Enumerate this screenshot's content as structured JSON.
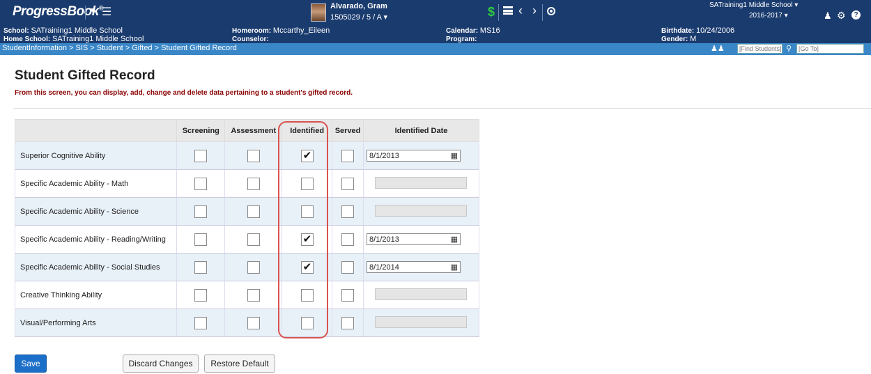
{
  "app": {
    "logo_text": "ProgressBook",
    "logo_mark": "®"
  },
  "student": {
    "name": "Alvarado, Gram",
    "id_line": "1505029  / 5 / A"
  },
  "header_right": {
    "school": "SATraining1 Middle School",
    "year": "2016-2017"
  },
  "info": {
    "school_label": "School:",
    "school_value": "SATraining1 Middle School",
    "home_school_label": "Home School:",
    "home_school_value": "SATraining1 Middle School",
    "homeroom_label": "Homeroom:",
    "homeroom_value": "Mccarthy_Eileen",
    "counselor_label": "Counselor:",
    "counselor_value": "",
    "calendar_label": "Calendar:",
    "calendar_value": "MS16",
    "program_label": "Program:",
    "program_value": "",
    "birthdate_label": "Birthdate:",
    "birthdate_value": "10/24/2006",
    "gender_label": "Gender:",
    "gender_value": "M"
  },
  "breadcrumb": "StudentInformation > SIS > Student > Gifted > Student Gifted Record",
  "search": {
    "find_placeholder": "[Find Students]",
    "goto_placeholder": "[Go To]"
  },
  "page": {
    "title": "Student Gifted Record",
    "description": "From this screen, you can display, add, change and delete data pertaining to a student's gifted record."
  },
  "table": {
    "headers": [
      "",
      "Screening",
      "Assessment",
      "Identified",
      "Served",
      "Identified Date"
    ],
    "rows": [
      {
        "name": "Superior Cognitive Ability",
        "screening": false,
        "assessment": false,
        "identified": true,
        "served": false,
        "date": "8/1/2013"
      },
      {
        "name": "Specific Academic Ability - Math",
        "screening": false,
        "assessment": false,
        "identified": false,
        "served": false,
        "date": ""
      },
      {
        "name": "Specific Academic Ability - Science",
        "screening": false,
        "assessment": false,
        "identified": false,
        "served": false,
        "date": ""
      },
      {
        "name": "Specific Academic Ability - Reading/Writing",
        "screening": false,
        "assessment": false,
        "identified": true,
        "served": false,
        "date": "8/1/2013"
      },
      {
        "name": "Specific Academic Ability - Social Studies",
        "screening": false,
        "assessment": false,
        "identified": true,
        "served": false,
        "date": "8/1/2014"
      },
      {
        "name": "Creative Thinking Ability",
        "screening": false,
        "assessment": false,
        "identified": false,
        "served": false,
        "date": ""
      },
      {
        "name": "Visual/Performing Arts",
        "screening": false,
        "assessment": false,
        "identified": false,
        "served": false,
        "date": ""
      }
    ]
  },
  "buttons": {
    "save": "Save",
    "discard": "Discard Changes",
    "restore": "Restore Default"
  },
  "colors": {
    "header_bg": "#1a3b6e",
    "breadcrumb_bg": "#3a87c8",
    "description_text": "#8b0000",
    "highlight_border": "#d9534f",
    "save_button": "#1c6fc9"
  },
  "icons": [
    "caret-down-icon",
    "menu-icon",
    "dollar-icon",
    "list-icon",
    "chevron-left-icon",
    "chevron-right-icon",
    "stop-icon",
    "user-icon",
    "gear-icon",
    "help-icon",
    "people-icon",
    "search-icon",
    "calendar-icon"
  ]
}
